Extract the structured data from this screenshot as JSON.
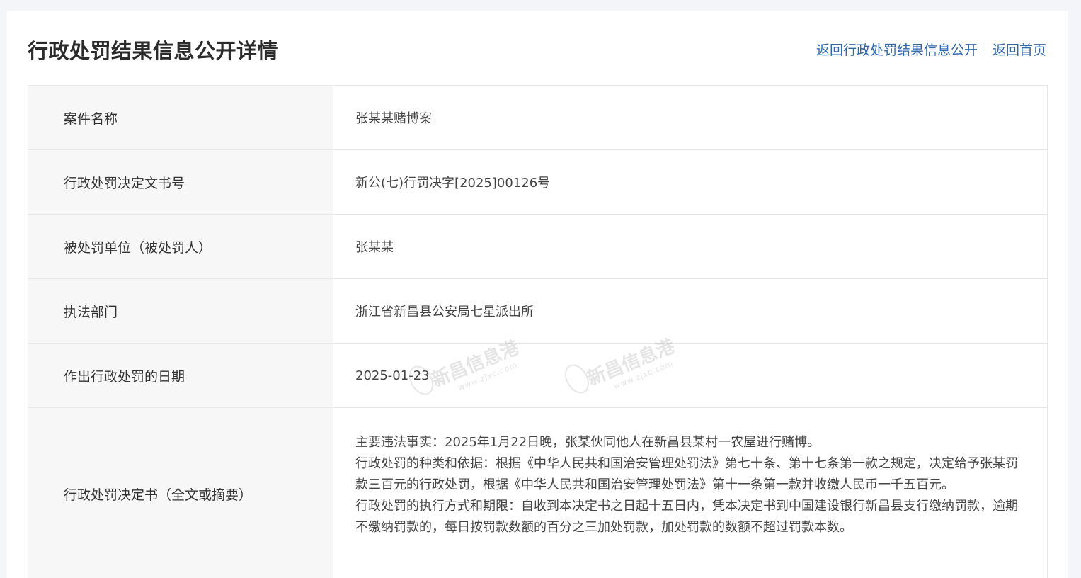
{
  "header": {
    "title": "行政处罚结果信息公开详情",
    "nav_back_list": "返回行政处罚结果信息公开",
    "nav_home": "返回首页"
  },
  "rows": [
    {
      "label": "案件名称",
      "value": "张某某赌博案"
    },
    {
      "label": "行政处罚决定文书号",
      "value": "新公(七)行罚决字[2025]00126号"
    },
    {
      "label": "被处罚单位（被处罚人）",
      "value": "张某某"
    },
    {
      "label": "执法部门",
      "value": "浙江省新昌县公安局七星派出所"
    },
    {
      "label": "作出行政处罚的日期",
      "value": "2025-01-23"
    }
  ],
  "decision": {
    "label": "行政处罚决定书（全文或摘要）",
    "paragraphs": [
      "主要违法事实：2025年1月22日晚，张某伙同他人在新昌县某村一农屋进行赌博。",
      "行政处罚的种类和依据：根据《中华人民共和国治安管理处罚法》第七十条、第十七条第一款之规定，决定给予张某罚款三百元的行政处罚，根据《中华人民共和国治安管理处罚法》第十一条第一款并收缴人民币一千五百元。",
      "行政处罚的执行方式和期限：自收到本决定书之日起十五日内，凭本决定书到中国建设银行新昌县支行缴纳罚款，逾期不缴纳罚款的，每日按罚款数额的百分之三加处罚款，加处罚款的数额不超过罚款本数。"
    ]
  },
  "watermark": {
    "name": "新昌信息港",
    "url": "www.zjxc.com"
  }
}
